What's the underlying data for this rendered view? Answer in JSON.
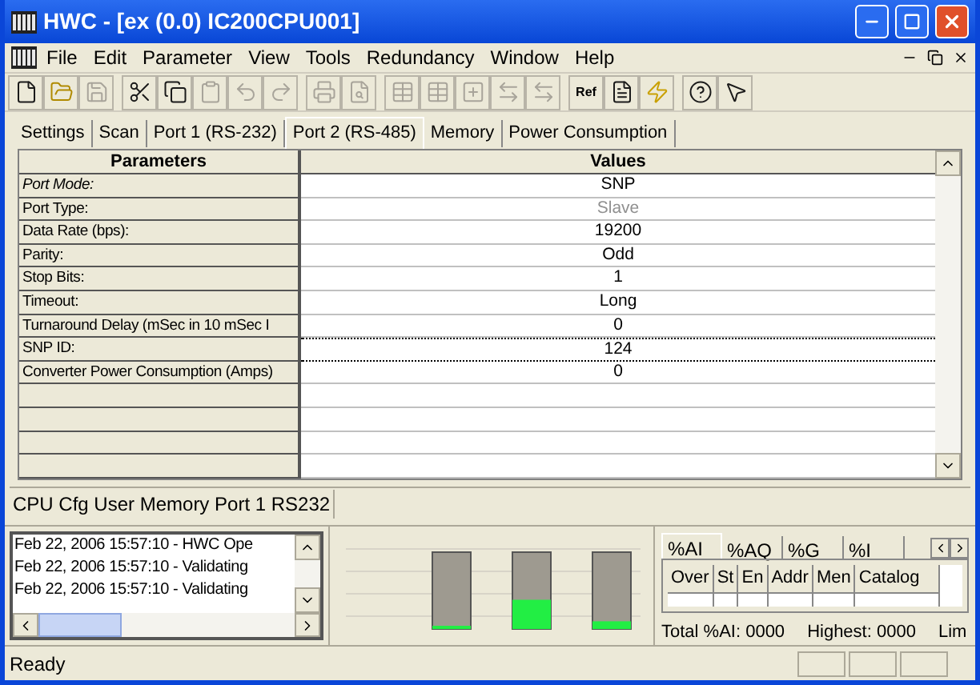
{
  "window": {
    "title": "HWC - [ex (0.0) IC200CPU001]"
  },
  "menu": [
    "File",
    "Edit",
    "Parameter",
    "View",
    "Tools",
    "Redundancy",
    "Window",
    "Help"
  ],
  "toolbar": [
    [
      {
        "kind": "new",
        "disabled": false
      },
      {
        "kind": "open",
        "disabled": false
      },
      {
        "kind": "save",
        "disabled": true
      }
    ],
    [
      {
        "kind": "cut",
        "disabled": false
      },
      {
        "kind": "copy",
        "disabled": false
      },
      {
        "kind": "paste",
        "disabled": true
      },
      {
        "kind": "undo",
        "disabled": true
      },
      {
        "kind": "redo",
        "disabled": true
      }
    ],
    [
      {
        "kind": "print",
        "disabled": true
      },
      {
        "kind": "preview",
        "disabled": true
      }
    ],
    [
      {
        "kind": "grid",
        "disabled": true
      },
      {
        "kind": "grid",
        "disabled": true
      },
      {
        "kind": "plus",
        "disabled": true
      },
      {
        "kind": "swap",
        "disabled": true
      },
      {
        "kind": "swap",
        "disabled": true
      }
    ],
    [
      {
        "kind": "ref",
        "label": "Ref",
        "disabled": false
      },
      {
        "kind": "doc",
        "disabled": false
      },
      {
        "kind": "bolt",
        "disabled": false
      }
    ],
    [
      {
        "kind": "help",
        "disabled": false
      },
      {
        "kind": "whatshelp",
        "disabled": false
      }
    ]
  ],
  "tabs": [
    {
      "label": "Settings",
      "selected": false
    },
    {
      "label": "Scan",
      "selected": false
    },
    {
      "label": "Port 1 (RS-232)",
      "selected": false
    },
    {
      "label": "Port 2 (RS-485)",
      "selected": true
    },
    {
      "label": "Memory",
      "selected": false
    },
    {
      "label": "Power Consumption",
      "selected": false
    }
  ],
  "table": {
    "columns": [
      "Parameters",
      "Values"
    ],
    "rows": [
      {
        "parameter": "Port Mode:",
        "value": "SNP",
        "italic": true,
        "disabled": false,
        "focused": false
      },
      {
        "parameter": "Port Type:",
        "value": "Slave",
        "italic": false,
        "disabled": true,
        "focused": false
      },
      {
        "parameter": "Data Rate (bps):",
        "value": "19200",
        "italic": false,
        "disabled": false,
        "focused": false
      },
      {
        "parameter": "Parity:",
        "value": "Odd",
        "italic": false,
        "disabled": false,
        "focused": false
      },
      {
        "parameter": "Stop Bits:",
        "value": "1",
        "italic": false,
        "disabled": false,
        "focused": false
      },
      {
        "parameter": "Timeout:",
        "value": "Long",
        "italic": false,
        "disabled": false,
        "focused": false
      },
      {
        "parameter": "Turnaround Delay (mSec in 10 mSec I",
        "value": "0",
        "italic": false,
        "disabled": false,
        "focused": false
      },
      {
        "parameter": "SNP ID:",
        "value": "124",
        "italic": false,
        "disabled": false,
        "focused": true
      },
      {
        "parameter": "Converter Power Consumption (Amps)",
        "value": "0",
        "italic": false,
        "disabled": false,
        "focused": false
      }
    ]
  },
  "info_bar": "CPU Cfg User Memory Port 1 RS232",
  "log": [
    "Feb 22, 2006 15:57:10 - HWC Ope",
    "Feb 22, 2006 15:57:10 - Validating",
    "Feb 22, 2006 15:57:10 - Validating"
  ],
  "gauges": [
    {
      "level": 0.02
    },
    {
      "level": 0.38
    },
    {
      "level": 0.1
    }
  ],
  "ref_panel": {
    "tabs": [
      {
        "label": "%AI",
        "selected": true
      },
      {
        "label": "%AQ",
        "selected": false
      },
      {
        "label": "%G",
        "selected": false
      },
      {
        "label": "%I",
        "selected": false
      }
    ],
    "columns": [
      "Over",
      "St",
      "En",
      "Addr",
      "Men",
      "Catalog"
    ],
    "footer": [
      "Total %AI: 0000",
      "Highest: 0000",
      "Lim"
    ]
  },
  "status_bar": {
    "text": "Ready"
  }
}
